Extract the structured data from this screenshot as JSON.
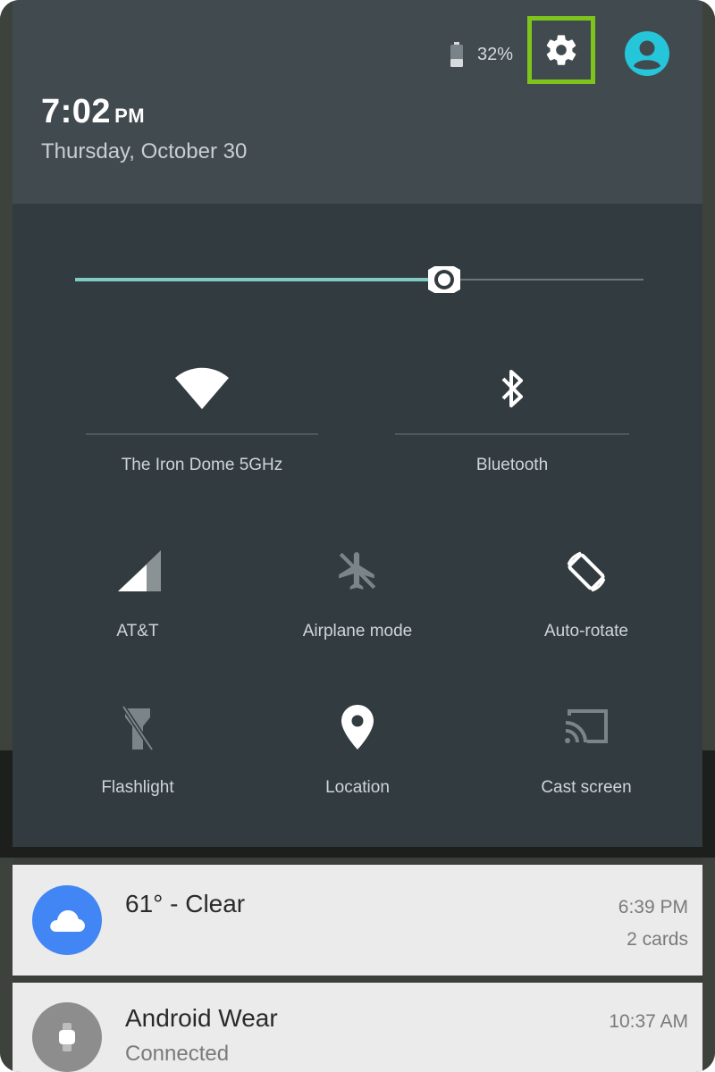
{
  "status": {
    "battery_percent": "32%",
    "time": "7:02",
    "ampm": "PM",
    "date": "Thursday, October 30"
  },
  "icons": {
    "settings": "gear-icon",
    "user": "account-icon",
    "battery": "battery-icon"
  },
  "brightness": {
    "level": 0.65
  },
  "tiles_top": [
    {
      "label": "The Iron Dome 5GHz",
      "icon": "wifi-icon"
    },
    {
      "label": "Bluetooth",
      "icon": "bluetooth-icon"
    }
  ],
  "tiles": [
    {
      "label": "AT&T",
      "icon": "cell-signal-icon"
    },
    {
      "label": "Airplane mode",
      "icon": "airplane-icon"
    },
    {
      "label": "Auto-rotate",
      "icon": "rotate-icon"
    },
    {
      "label": "Flashlight",
      "icon": "flashlight-icon"
    },
    {
      "label": "Location",
      "icon": "location-pin-icon"
    },
    {
      "label": "Cast screen",
      "icon": "cast-icon"
    }
  ],
  "notifications": [
    {
      "title": "61° - Clear",
      "time": "6:39 PM",
      "meta": "2 cards",
      "icon": "cloud-icon"
    },
    {
      "title": "Android Wear",
      "subtitle": "Connected",
      "time": "10:37 AM",
      "icon": "watch-icon"
    }
  ],
  "colors": {
    "accent": "#80cbc4",
    "highlight": "#7dc51d",
    "avatar": "#26c6da",
    "weather": "#4285f4"
  }
}
